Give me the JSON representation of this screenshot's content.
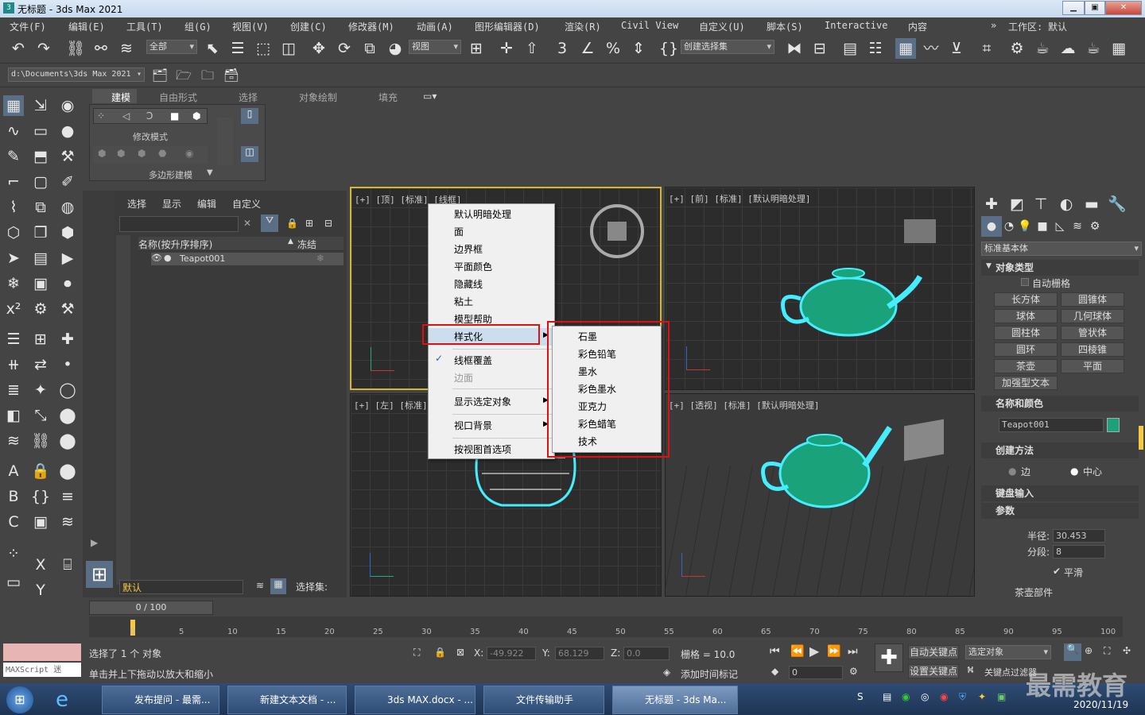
{
  "title": "无标题 - 3ds Max 2021",
  "menus": [
    "文件(F)",
    "编辑(E)",
    "工具(T)",
    "组(G)",
    "视图(V)",
    "创建(C)",
    "修改器(M)",
    "动画(A)",
    "图形编辑器(D)",
    "渲染(R)",
    "Civil View",
    "自定义(U)",
    "脚本(S)",
    "Interactive",
    "内容"
  ],
  "workspace_label": "工作区:",
  "workspace_value": "默认",
  "selection_filter": "全部",
  "view_dropdown": "视图",
  "named_set": "创建选择集",
  "path": "d:\\Documents\\3ds Max 2021",
  "ribbon_tabs": [
    "建模",
    "自由形式",
    "选择",
    "对象绘制",
    "填充"
  ],
  "ribbon_modify": "修改模式",
  "ribbon_poly": "多边形建模",
  "scene_tabs": [
    "选择",
    "显示",
    "编辑",
    "自定义"
  ],
  "scene_col_name": "名称(按升序排序)",
  "scene_col_freeze": "冻结",
  "scene_item": "Teapot001",
  "layer": "默认",
  "selset": "选择集:",
  "vp_top": "[+] [顶] [标准] [线框]",
  "vp_front": "[+] [前] [标准] [默认明暗处理]",
  "vp_left": "[+] [左] [标准] [",
  "vp_persp": "[+] [透视] [标准] [默认明暗处理]",
  "ctx_menu": [
    "默认明暗处理",
    "面",
    "边界框",
    "平面颜色",
    "隐藏线",
    "粘土",
    "模型帮助",
    "样式化",
    "线框覆盖",
    "边面",
    "显示选定对象",
    "视口背景",
    "按视图首选项"
  ],
  "sub_menu": [
    "石墨",
    "彩色铅笔",
    "墨水",
    "彩色墨水",
    "亚克力",
    "彩色蜡笔",
    "技术"
  ],
  "cmd_category": "标准基本体",
  "sec_objtype": "对象类型",
  "autogrid": "自动栅格",
  "prims": [
    "长方体",
    "圆锥体",
    "球体",
    "几何球体",
    "圆柱体",
    "管状体",
    "圆环",
    "四棱锥",
    "茶壶",
    "平面",
    "加强型文本"
  ],
  "sec_name": "名称和颜色",
  "obj_name": "Teapot001",
  "sec_method": "创建方法",
  "method_edge": "边",
  "method_center": "中心",
  "sec_keyboard": "键盘输入",
  "sec_params": "参数",
  "radius_label": "半径:",
  "radius": "30.453",
  "segs_label": "分段:",
  "segs": "8",
  "smooth": "平滑",
  "parts": "茶壶部件",
  "timeline": "0 / 100",
  "ticks": [
    "0",
    "5",
    "10",
    "15",
    "20",
    "25",
    "30",
    "35",
    "40",
    "45",
    "50",
    "55",
    "60",
    "65",
    "70",
    "75",
    "80",
    "85",
    "90",
    "95",
    "100"
  ],
  "status1": "选择了 1 个 对象",
  "status2": "单击并上下拖动以放大和缩小",
  "maxscript": "MAXScript 迷",
  "x_label": "X:",
  "x_val": "-49.922",
  "y_label": "Y:",
  "y_val": "68.129",
  "z_label": "Z:",
  "z_val": "0.0",
  "grid_label": "栅格 = 10.0",
  "add_tag": "添加时间标记",
  "autokey": "自动关键点",
  "setkey": "设置关键点",
  "sel_obj": "选定对象",
  "key_filter": "关键点过滤器",
  "frame": "0",
  "tasks": [
    "发布提问 - 最需...",
    "新建文本文档 - ...",
    "3ds MAX.docx - ...",
    "文件传输助手",
    "无标题 - 3ds Ma..."
  ],
  "date": "2020/11/19",
  "watermark": "最需教育"
}
